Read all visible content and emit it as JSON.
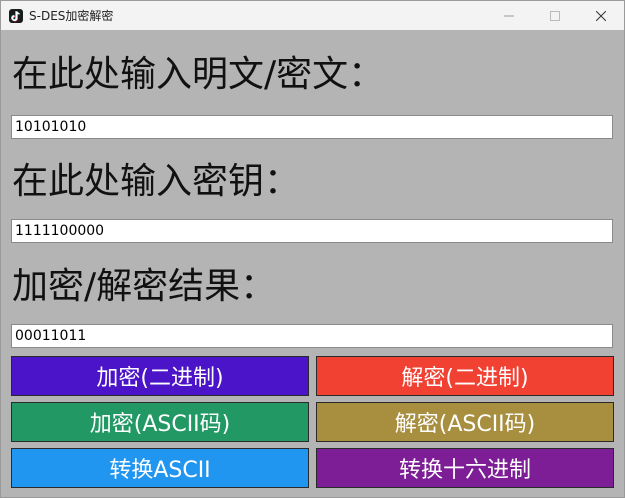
{
  "window": {
    "title": "S-DES加密解密"
  },
  "plaintext": {
    "label": "在此处输入明文/密文：",
    "value": "10101010"
  },
  "key": {
    "label": "在此处输入密钥：",
    "value": "1111100000"
  },
  "result": {
    "label": "加密/解密结果：",
    "value": "00011011"
  },
  "buttons": {
    "encrypt_binary": {
      "label": "加密(二进制)",
      "color": "#4B14C8"
    },
    "decrypt_binary": {
      "label": "解密(二进制)",
      "color": "#F04132"
    },
    "encrypt_ascii": {
      "label": "加密(ASCII码)",
      "color": "#229964"
    },
    "decrypt_ascii": {
      "label": "解密(ASCII码)",
      "color": "#A88E3F"
    },
    "to_ascii": {
      "label": "转换ASCII",
      "color": "#2196F0"
    },
    "to_hex": {
      "label": "转换十六进制",
      "color": "#7D1E96"
    }
  },
  "icons": {
    "app": "app-icon",
    "minimize": "minimize-icon",
    "maximize": "maximize-icon",
    "close": "close-icon"
  }
}
